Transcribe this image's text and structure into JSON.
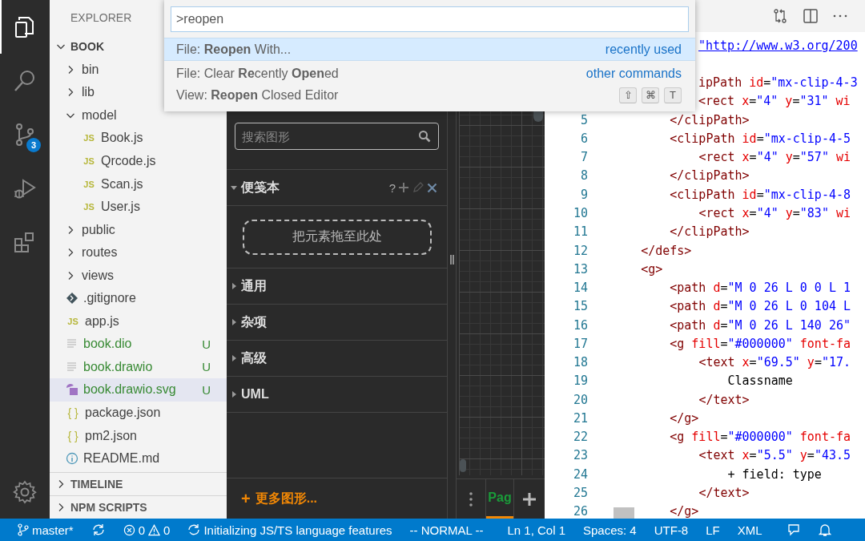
{
  "activity_bar": {
    "items": [
      {
        "kind": "files",
        "selected": true
      },
      {
        "kind": "search",
        "selected": false
      },
      {
        "kind": "source-control",
        "selected": false,
        "badge": "3"
      },
      {
        "kind": "run-debug",
        "selected": false
      },
      {
        "kind": "extensions",
        "selected": false
      }
    ],
    "bottom": {
      "kind": "settings"
    }
  },
  "explorer": {
    "title": "EXPLORER",
    "tree": {
      "label": "BOOK",
      "expanded": true,
      "children": [
        {
          "label": "bin",
          "kind": "folder",
          "expanded": false,
          "selected": false
        },
        {
          "label": "lib",
          "kind": "folder",
          "expanded": false,
          "selected": false
        },
        {
          "label": "model",
          "kind": "folder",
          "expanded": true,
          "selected": false,
          "children": [
            {
              "label": "Book.js",
              "kind": "js",
              "icon": "JS",
              "selected": false,
              "untracked": false
            },
            {
              "label": "Qrcode.js",
              "kind": "js",
              "icon": "JS",
              "selected": false,
              "untracked": false
            },
            {
              "label": "Scan.js",
              "kind": "js",
              "icon": "JS",
              "selected": false,
              "untracked": false
            },
            {
              "label": "User.js",
              "kind": "js",
              "icon": "JS",
              "selected": false,
              "untracked": false
            }
          ]
        },
        {
          "label": "public",
          "kind": "folder",
          "expanded": false,
          "selected": false
        },
        {
          "label": "routes",
          "kind": "folder",
          "expanded": false,
          "selected": false
        },
        {
          "label": "views",
          "kind": "folder",
          "expanded": false,
          "selected": false
        },
        {
          "label": ".gitignore",
          "kind": "git",
          "selected": false,
          "untracked": false
        },
        {
          "label": "app.js",
          "kind": "js",
          "icon": "JS",
          "selected": false,
          "untracked": false
        },
        {
          "label": "book.dio",
          "kind": "text",
          "selected": false,
          "untracked": true,
          "badge": "U"
        },
        {
          "label": "book.drawio",
          "kind": "text",
          "selected": false,
          "untracked": true,
          "badge": "U"
        },
        {
          "label": "book.drawio.svg",
          "kind": "image",
          "selected": true,
          "untracked": true,
          "badge": "U"
        },
        {
          "label": "package.json",
          "kind": "json",
          "icon": "{ }",
          "selected": false,
          "untracked": false
        },
        {
          "label": "pm2.json",
          "kind": "json",
          "icon": "{ }",
          "selected": false,
          "untracked": false
        },
        {
          "label": "README.md",
          "kind": "info",
          "selected": false,
          "untracked": false
        }
      ]
    },
    "sections": [
      {
        "label": "TIMELINE",
        "expanded": false
      },
      {
        "label": "NPM SCRIPTS",
        "expanded": false
      }
    ]
  },
  "command_palette": {
    "value": ">reopen",
    "items": [
      {
        "label": "File: **Reopen** With...",
        "group": "recently used",
        "selected": true
      },
      {
        "label": "File: Clear **Re**cently **Open**ed",
        "group": "other commands",
        "selected": false
      },
      {
        "label": "View: **Reopen** Closed Editor",
        "keys": [
          "⇧",
          "⌘",
          "T"
        ],
        "selected": false
      }
    ]
  },
  "drawio": {
    "search": {
      "placeholder": "搜索图形"
    },
    "sections": [
      {
        "label": "便笺本",
        "expanded": true,
        "help": "?",
        "drop_hint": "把元素拖至此处"
      },
      {
        "label": "通用",
        "expanded": false
      },
      {
        "label": "杂项",
        "expanded": false
      },
      {
        "label": "高级",
        "expanded": false
      },
      {
        "label": "UML",
        "expanded": false
      }
    ],
    "more_shapes": {
      "plus": "+",
      "label": "更多图形..."
    },
    "page_tab": {
      "label": "Pag",
      "selected": true
    }
  },
  "editor": {
    "lines": [
      {
        "kind": "covered",
        "tokens": [
          {
            "kind": "link",
            "text": "\"http://www.w3.org/200"
          }
        ]
      },
      {
        "kind": "covered"
      },
      {
        "kind": "covered",
        "tokens": [
          {
            "kind": "tag",
            "text": "ipPath"
          },
          {
            "kind": "attr",
            "text": " id"
          },
          {
            "kind": "plain",
            "text": "="
          },
          {
            "kind": "value",
            "text": "\"mx-clip-4-3"
          }
        ]
      },
      {
        "kind": "covered",
        "tokens": [
          {
            "kind": "tag",
            "text": "<rect"
          },
          {
            "kind": "attr",
            "text": " x"
          },
          {
            "kind": "plain",
            "text": "="
          },
          {
            "kind": "value",
            "text": "\"4\""
          },
          {
            "kind": "attr",
            "text": " y"
          },
          {
            "kind": "plain",
            "text": "="
          },
          {
            "kind": "value",
            "text": "\"31\""
          },
          {
            "kind": "attr",
            "text": " wi"
          }
        ]
      },
      {
        "kind": "full",
        "number": "5",
        "tokens": [
          {
            "kind": "tag",
            "text": "        </clipPath>"
          }
        ]
      },
      {
        "kind": "full",
        "number": "6",
        "tokens": [
          {
            "kind": "tag",
            "text": "        <clipPath"
          },
          {
            "kind": "attr",
            "text": " id"
          },
          {
            "kind": "plain",
            "text": "="
          },
          {
            "kind": "value",
            "text": "\"mx-clip-4-5"
          }
        ]
      },
      {
        "kind": "full",
        "number": "7",
        "tokens": [
          {
            "kind": "tag",
            "text": "            <rect"
          },
          {
            "kind": "attr",
            "text": " x"
          },
          {
            "kind": "plain",
            "text": "="
          },
          {
            "kind": "value",
            "text": "\"4\""
          },
          {
            "kind": "attr",
            "text": " y"
          },
          {
            "kind": "plain",
            "text": "="
          },
          {
            "kind": "value",
            "text": "\"57\""
          },
          {
            "kind": "attr",
            "text": " wi"
          }
        ]
      },
      {
        "kind": "full",
        "number": "8",
        "tokens": [
          {
            "kind": "tag",
            "text": "        </clipPath>"
          }
        ]
      },
      {
        "kind": "full",
        "number": "9",
        "tokens": [
          {
            "kind": "tag",
            "text": "        <clipPath"
          },
          {
            "kind": "attr",
            "text": " id"
          },
          {
            "kind": "plain",
            "text": "="
          },
          {
            "kind": "value",
            "text": "\"mx-clip-4-8"
          }
        ]
      },
      {
        "kind": "full",
        "number": "10",
        "tokens": [
          {
            "kind": "tag",
            "text": "            <rect"
          },
          {
            "kind": "attr",
            "text": " x"
          },
          {
            "kind": "plain",
            "text": "="
          },
          {
            "kind": "value",
            "text": "\"4\""
          },
          {
            "kind": "attr",
            "text": " y"
          },
          {
            "kind": "plain",
            "text": "="
          },
          {
            "kind": "value",
            "text": "\"83\""
          },
          {
            "kind": "attr",
            "text": " wi"
          }
        ]
      },
      {
        "kind": "full",
        "number": "11",
        "tokens": [
          {
            "kind": "tag",
            "text": "        </clipPath>"
          }
        ]
      },
      {
        "kind": "full",
        "number": "12",
        "tokens": [
          {
            "kind": "tag",
            "text": "    </defs>"
          }
        ]
      },
      {
        "kind": "full",
        "number": "13",
        "tokens": [
          {
            "kind": "tag",
            "text": "    <g>"
          }
        ]
      },
      {
        "kind": "full",
        "number": "14",
        "tokens": [
          {
            "kind": "tag",
            "text": "        <path"
          },
          {
            "kind": "attr",
            "text": " d"
          },
          {
            "kind": "plain",
            "text": "="
          },
          {
            "kind": "value",
            "text": "\"M 0 26 L 0 0 L 1"
          }
        ]
      },
      {
        "kind": "full",
        "number": "15",
        "tokens": [
          {
            "kind": "tag",
            "text": "        <path"
          },
          {
            "kind": "attr",
            "text": " d"
          },
          {
            "kind": "plain",
            "text": "="
          },
          {
            "kind": "value",
            "text": "\"M 0 26 L 0 104 L"
          }
        ]
      },
      {
        "kind": "full",
        "number": "16",
        "tokens": [
          {
            "kind": "tag",
            "text": "        <path"
          },
          {
            "kind": "attr",
            "text": " d"
          },
          {
            "kind": "plain",
            "text": "="
          },
          {
            "kind": "value",
            "text": "\"M 0 26 L 140 26\""
          }
        ]
      },
      {
        "kind": "full",
        "number": "17",
        "tokens": [
          {
            "kind": "tag",
            "text": "        <g"
          },
          {
            "kind": "attr",
            "text": " fill"
          },
          {
            "kind": "plain",
            "text": "="
          },
          {
            "kind": "value",
            "text": "\"#000000\""
          },
          {
            "kind": "attr",
            "text": " font-fa"
          }
        ]
      },
      {
        "kind": "full",
        "number": "18",
        "tokens": [
          {
            "kind": "tag",
            "text": "            <text"
          },
          {
            "kind": "attr",
            "text": " x"
          },
          {
            "kind": "plain",
            "text": "="
          },
          {
            "kind": "value",
            "text": "\"69.5\""
          },
          {
            "kind": "attr",
            "text": " y"
          },
          {
            "kind": "plain",
            "text": "="
          },
          {
            "kind": "value",
            "text": "\"17."
          }
        ]
      },
      {
        "kind": "full",
        "number": "19",
        "tokens": [
          {
            "kind": "plain",
            "text": "                Classname"
          }
        ]
      },
      {
        "kind": "full",
        "number": "20",
        "tokens": [
          {
            "kind": "tag",
            "text": "            </text>"
          }
        ]
      },
      {
        "kind": "full",
        "number": "21",
        "tokens": [
          {
            "kind": "tag",
            "text": "        </g>"
          }
        ]
      },
      {
        "kind": "full",
        "number": "22",
        "tokens": [
          {
            "kind": "tag",
            "text": "        <g"
          },
          {
            "kind": "attr",
            "text": " fill"
          },
          {
            "kind": "plain",
            "text": "="
          },
          {
            "kind": "value",
            "text": "\"#000000\""
          },
          {
            "kind": "attr",
            "text": " font-fa"
          }
        ]
      },
      {
        "kind": "full",
        "number": "23",
        "tokens": [
          {
            "kind": "tag",
            "text": "            <text"
          },
          {
            "kind": "attr",
            "text": " x"
          },
          {
            "kind": "plain",
            "text": "="
          },
          {
            "kind": "value",
            "text": "\"5.5\""
          },
          {
            "kind": "attr",
            "text": " y"
          },
          {
            "kind": "plain",
            "text": "="
          },
          {
            "kind": "value",
            "text": "\"43.5"
          }
        ]
      },
      {
        "kind": "full",
        "number": "24",
        "tokens": [
          {
            "kind": "plain",
            "text": "                + field: type"
          }
        ]
      },
      {
        "kind": "full",
        "number": "25",
        "tokens": [
          {
            "kind": "tag",
            "text": "            </text>"
          }
        ]
      },
      {
        "kind": "full",
        "number": "26",
        "tokens": [
          {
            "kind": "tag",
            "text": "        </g>"
          }
        ]
      }
    ]
  },
  "status_bar": {
    "branch": "master*",
    "errors": "0",
    "warnings": "0",
    "progress": "Initializing JS/TS language features",
    "mode": "-- NORMAL --",
    "position": "Ln 1, Col 1",
    "indent": "Spaces: 4",
    "encoding": "UTF-8",
    "eol": "LF",
    "language": "XML"
  }
}
